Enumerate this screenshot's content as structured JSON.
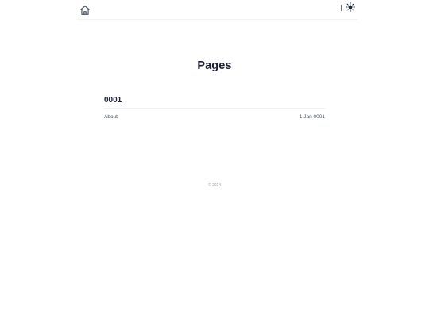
{
  "header": {
    "home_icon": "home-icon",
    "theme_icon": "sun-icon"
  },
  "main": {
    "title": "Pages",
    "sections": [
      {
        "heading": "0001",
        "entries": [
          {
            "title": "About",
            "date": "1 Jan 0001"
          }
        ]
      }
    ]
  },
  "footer": {
    "copyright": "© 2024"
  },
  "colors": {
    "heading": "#1e2236",
    "text": "#4b5563",
    "muted": "#9ca3af",
    "divider": "#eef0f3"
  }
}
